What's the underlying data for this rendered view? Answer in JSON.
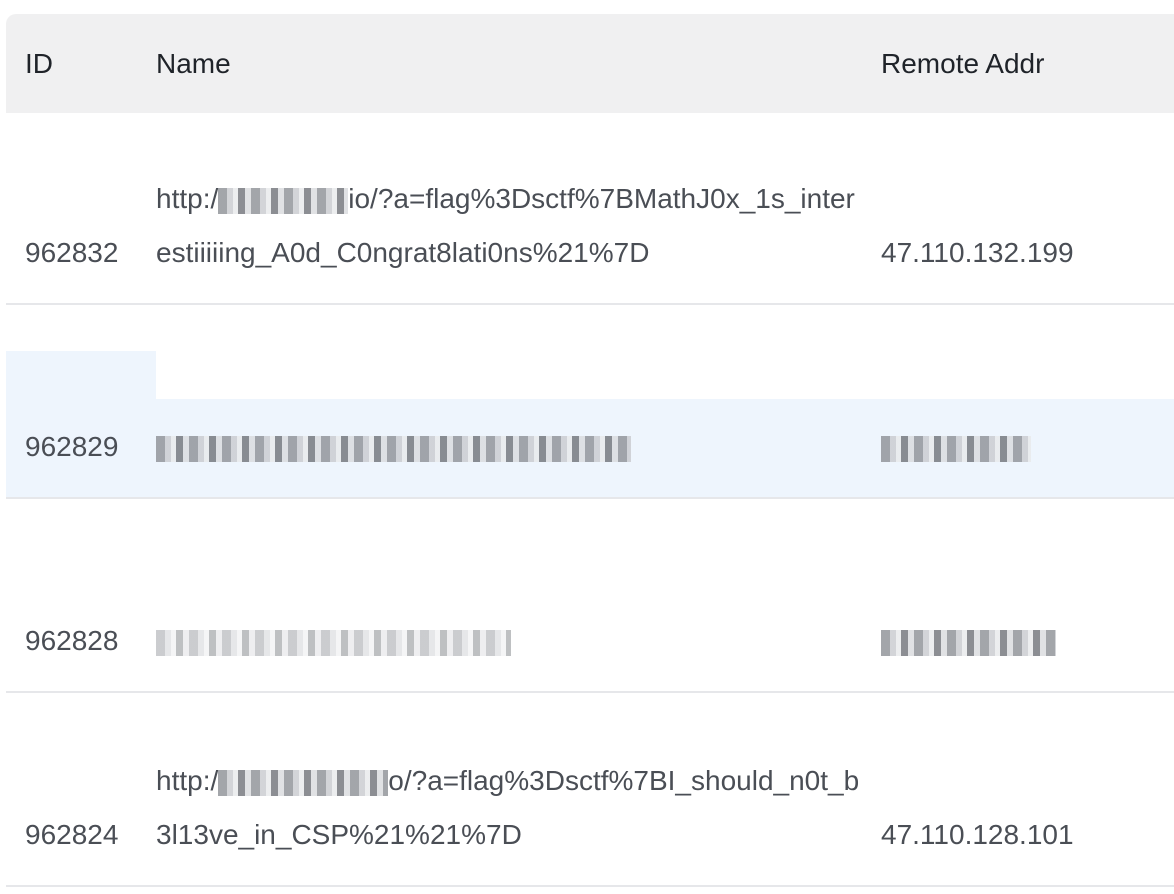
{
  "table": {
    "headers": {
      "id": "ID",
      "name": "Name",
      "remote_addr": "Remote Addr"
    },
    "rows": [
      {
        "id": "962832",
        "name_prefix": "http:/",
        "name_suffix": "io/?a=flag%3Dsctf%7BMathJ0x_1s_interestiiiiing_A0d_C0ngrat8lati0ns%21%7D",
        "remote_addr": "47.110.132.199",
        "highlighted": false
      },
      {
        "id": "962829",
        "name_prefix": "",
        "name_suffix": "",
        "remote_addr": "",
        "highlighted": true
      },
      {
        "id": "962828",
        "name_prefix": "",
        "name_suffix": "",
        "remote_addr": "",
        "highlighted": false
      },
      {
        "id": "962824",
        "name_prefix": "http:/",
        "name_suffix": "o/?a=flag%3Dsctf%7BI_should_n0t_b3l13ve_in_CSP%21%21%7D",
        "remote_addr": "47.110.128.101",
        "highlighted": false
      }
    ]
  }
}
